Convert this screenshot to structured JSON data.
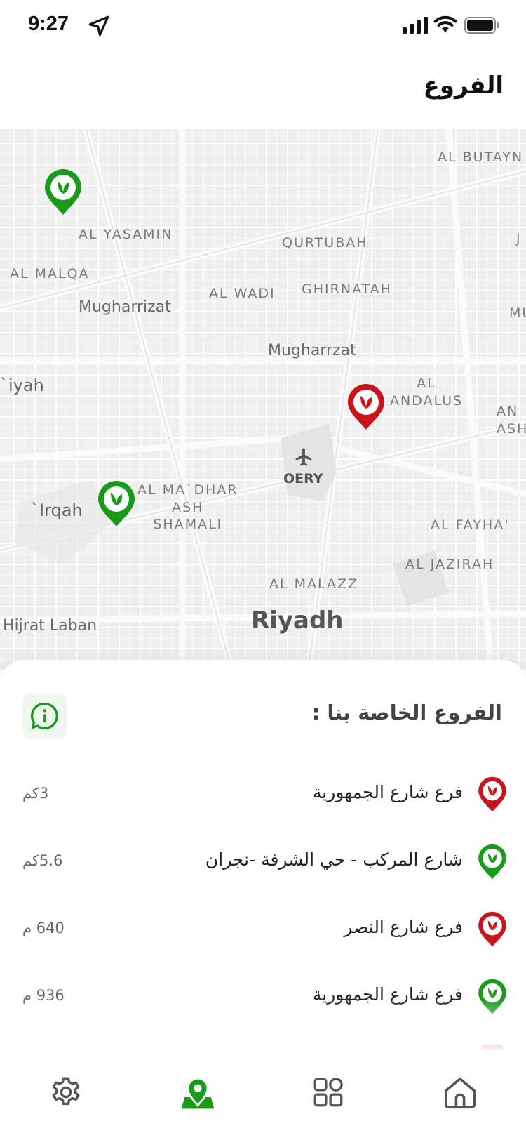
{
  "status": {
    "time": "9:27"
  },
  "header": {
    "title": "الفروع"
  },
  "map": {
    "labels": {
      "al_butayn": "AL BUTAYN",
      "al_yasamin": "AL YASAMIN",
      "qurtubah": "QURTUBAH",
      "al_malqa": "AL MALQA",
      "al_wadi": "AL WADI",
      "ghirnatah": "GHIRNATAH",
      "mugharrizat_1": "Mugharrizat",
      "mugharrzat_2": "Mugharrzat",
      "iyah": "`iyah",
      "al_andalus": "AL\nANDALUS",
      "an_ash": "AN\nASH",
      "oery": "OERY",
      "al_madhar": "AL MA`DHAR\nASH\nSHAMALI",
      "irqah": "`Irqah",
      "al_fayha": "AL FAYHA'",
      "al_jazirah": "AL JAZIRAH",
      "al_malazz": "AL MALAZZ",
      "hijrat_laban": "Hijrat Laban",
      "riyadh": "Riyadh",
      "edge_j": "J",
      "edge_mu": "MU"
    }
  },
  "sheet": {
    "title": "الفروع الخاصة بنا :",
    "branches": [
      {
        "name": "فرع شارع الجمهورية",
        "distance": "3كم",
        "status": "red"
      },
      {
        "name": "شارع المركب - حي الشرفة -نجران",
        "distance": "5.6كم",
        "status": "green"
      },
      {
        "name": "فرع شارع النصر",
        "distance": "640 م",
        "status": "red"
      },
      {
        "name": "فرع شارع الجمهورية",
        "distance": "936 م",
        "status": "green"
      }
    ]
  },
  "colors": {
    "green": "#1a9a1a",
    "red": "#c8151b",
    "text": "#222222",
    "muted": "#666666"
  },
  "tabs": [
    {
      "id": "settings",
      "icon": "gear-icon"
    },
    {
      "id": "branches",
      "icon": "location-icon",
      "active": true
    },
    {
      "id": "categories",
      "icon": "grid-icon"
    },
    {
      "id": "home",
      "icon": "home-icon"
    }
  ]
}
